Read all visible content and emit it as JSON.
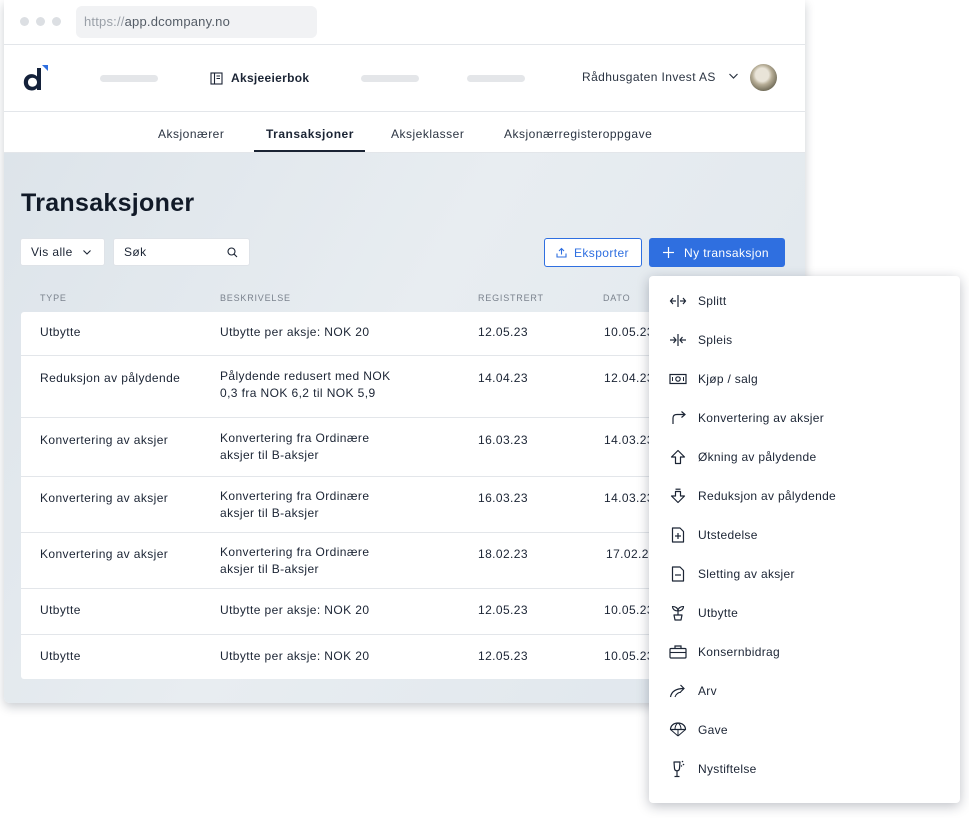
{
  "browser": {
    "url_scheme": "https://",
    "url_host": "app.dcompany.no"
  },
  "header": {
    "nav_title": "Aksjeeierbok",
    "company": "Rådhusgaten Invest AS"
  },
  "subnav": {
    "tabs": [
      {
        "label": "Aksjonærer"
      },
      {
        "label": "Transaksjoner",
        "active": true
      },
      {
        "label": "Aksjeklasser"
      },
      {
        "label": "Aksjonærregisteroppgave"
      }
    ]
  },
  "page": {
    "title": "Transaksjoner",
    "filter_label": "Vis alle",
    "search_placeholder": "Søk",
    "export_label": "Eksporter",
    "new_label": "Ny transaksjon"
  },
  "table": {
    "headers": {
      "type": "Type",
      "description": "Beskrivelse",
      "registered": "Registrert",
      "date": "Dato"
    },
    "rows": [
      {
        "type": "Utbytte",
        "desc1": "Utbytte per aksje: NOK 20",
        "desc2": "",
        "registered": "12.05.23",
        "date": "10.05.23"
      },
      {
        "type": "Reduksjon av pålydende",
        "desc1": "Pålydende redusert med NOK",
        "desc2": "0,3 fra NOK 6,2 til NOK 5,9",
        "registered": "14.04.23",
        "date": "12.04.23"
      },
      {
        "type": "Konvertering av aksjer",
        "desc1": "Konvertering fra Ordinære",
        "desc2": "aksjer til B-aksjer",
        "registered": "16.03.23",
        "date": "14.03.23"
      },
      {
        "type": "Konvertering av aksjer",
        "desc1": "Konvertering fra Ordinære",
        "desc2": "aksjer til B-aksjer",
        "registered": "16.03.23",
        "date": "14.03.23"
      },
      {
        "type": "Konvertering av aksjer",
        "desc1": "Konvertering fra Ordinære",
        "desc2": "aksjer til B-aksjer",
        "registered": "18.02.23",
        "date": "17.02.23"
      },
      {
        "type": "Utbytte",
        "desc1": "Utbytte per aksje: NOK 20",
        "desc2": "",
        "registered": "12.05.23",
        "date": "10.05.23"
      },
      {
        "type": "Utbytte",
        "desc1": "Utbytte per aksje: NOK 20",
        "desc2": "",
        "registered": "12.05.23",
        "date": "10.05.23"
      }
    ]
  },
  "menu": {
    "items": [
      {
        "label": "Splitt",
        "icon": "split-icon"
      },
      {
        "label": "Spleis",
        "icon": "merge-icon"
      },
      {
        "label": "Kjøp / salg",
        "icon": "banknote-icon"
      },
      {
        "label": "Konvertering av aksjer",
        "icon": "redirect-arrow-icon"
      },
      {
        "label": "Økning av pålydende",
        "icon": "arrow-up-icon"
      },
      {
        "label": "Reduksjon av pålydende",
        "icon": "arrow-down-icon"
      },
      {
        "label": "Utstedelse",
        "icon": "file-plus-icon"
      },
      {
        "label": "Sletting av aksjer",
        "icon": "file-minus-icon"
      },
      {
        "label": "Utbytte",
        "icon": "sprout-icon"
      },
      {
        "label": "Konsernbidrag",
        "icon": "briefcase-icon"
      },
      {
        "label": "Arv",
        "icon": "forward-arrow-icon"
      },
      {
        "label": "Gave",
        "icon": "parachute-icon"
      },
      {
        "label": "Nystiftelse",
        "icon": "champagne-icon"
      }
    ]
  },
  "colors": {
    "accent": "#2f6fe0",
    "logo_dark": "#14213a",
    "logo_accent": "#2f6fe0"
  }
}
